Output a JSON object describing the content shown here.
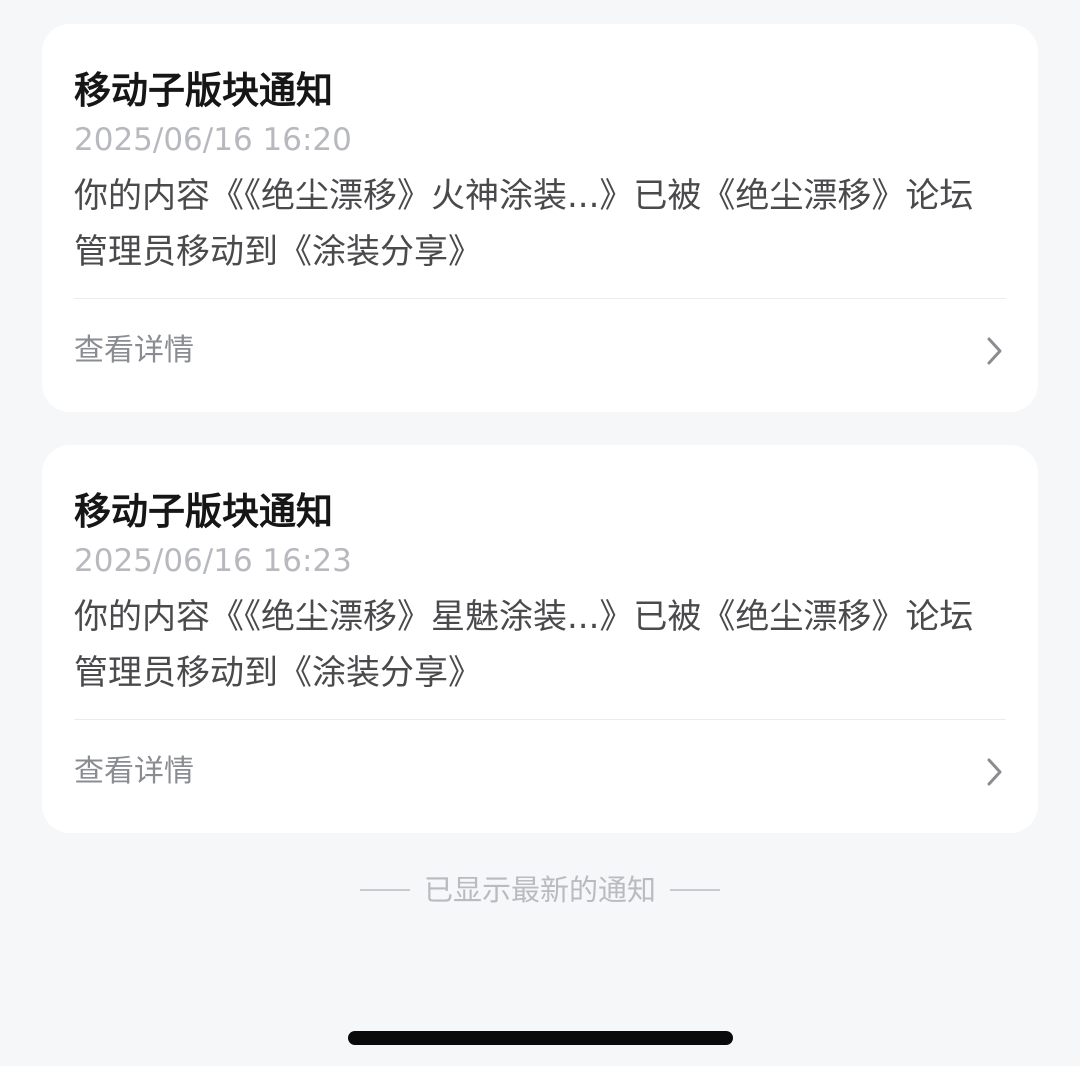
{
  "notifications": [
    {
      "title": "移动子版块通知",
      "time": "2025/06/16 16:20",
      "body": "你的内容《《绝尘漂移》火神涂装...》已被《绝尘漂移》论坛管理员移动到《涂装分享》",
      "action_label": "查看详情",
      "action_icon": "chevron-right-icon"
    },
    {
      "title": "移动子版块通知",
      "time": "2025/06/16 16:23",
      "body": "你的内容《《绝尘漂移》星魅涂装...》已被《绝尘漂移》论坛管理员移动到《涂装分享》",
      "action_label": "查看详情",
      "action_icon": "chevron-right-icon"
    }
  ],
  "footer": {
    "text": "已显示最新的通知"
  },
  "colors": {
    "background": "#f6f7f9",
    "card": "#ffffff",
    "title": "#161616",
    "timestamp": "#b7b9be",
    "body": "#4a4a4c",
    "muted": "#8a8c91"
  }
}
